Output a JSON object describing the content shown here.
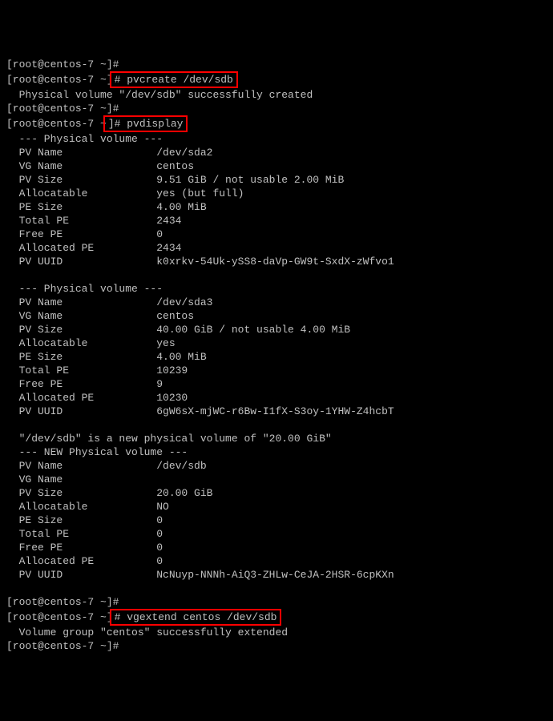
{
  "prompts": {
    "line1": "[root@centos-7 ~]#",
    "line2_prefix": "[root@centos-7 ~]",
    "line2_cmd": "# pvcreate /dev/sdb",
    "line3": "  Physical volume \"/dev/sdb\" successfully created",
    "line4": "[root@centos-7 ~]#",
    "line5_prefix": "[root@centos-7 ~",
    "line5_cmd": "]# pvdisplay",
    "line_vgext_prefix": "[root@centos-7 ~]",
    "line_vgext_cmd": "# vgextend centos /dev/sdb",
    "line_vgext_result": "  Volume group \"centos\" successfully extended",
    "line_last": "[root@centos-7 ~]#",
    "line_before_vgext": "[root@centos-7 ~]#"
  },
  "pv1": {
    "header": "  --- Physical volume ---",
    "name": "  PV Name               /dev/sda2",
    "vgname": "  VG Name               centos",
    "size": "  PV Size               9.51 GiB / not usable 2.00 MiB",
    "alloc": "  Allocatable           yes (but full)",
    "pesize": "  PE Size               4.00 MiB",
    "totalpe": "  Total PE              2434",
    "freepe": "  Free PE               0",
    "allocpe": "  Allocated PE          2434",
    "uuid": "  PV UUID               k0xrkv-54Uk-ySS8-daVp-GW9t-SxdX-zWfvo1"
  },
  "blank": " ",
  "pv2": {
    "header": "  --- Physical volume ---",
    "name": "  PV Name               /dev/sda3",
    "vgname": "  VG Name               centos",
    "size": "  PV Size               40.00 GiB / not usable 4.00 MiB",
    "alloc": "  Allocatable           yes",
    "pesize": "  PE Size               4.00 MiB",
    "totalpe": "  Total PE              10239",
    "freepe": "  Free PE               9",
    "allocpe": "  Allocated PE          10230",
    "uuid": "  PV UUID               6gW6sX-mjWC-r6Bw-I1fX-S3oy-1YHW-Z4hcbT"
  },
  "pv3": {
    "newmsg": "  \"/dev/sdb\" is a new physical volume of \"20.00 GiB\"",
    "header": "  --- NEW Physical volume ---",
    "name": "  PV Name               /dev/sdb",
    "vgname": "  VG Name",
    "size": "  PV Size               20.00 GiB",
    "alloc": "  Allocatable           NO",
    "pesize": "  PE Size               0",
    "totalpe": "  Total PE              0",
    "freepe": "  Free PE               0",
    "allocpe": "  Allocated PE          0",
    "uuid": "  PV UUID               NcNuyp-NNNh-AiQ3-ZHLw-CeJA-2HSR-6cpKXn"
  }
}
